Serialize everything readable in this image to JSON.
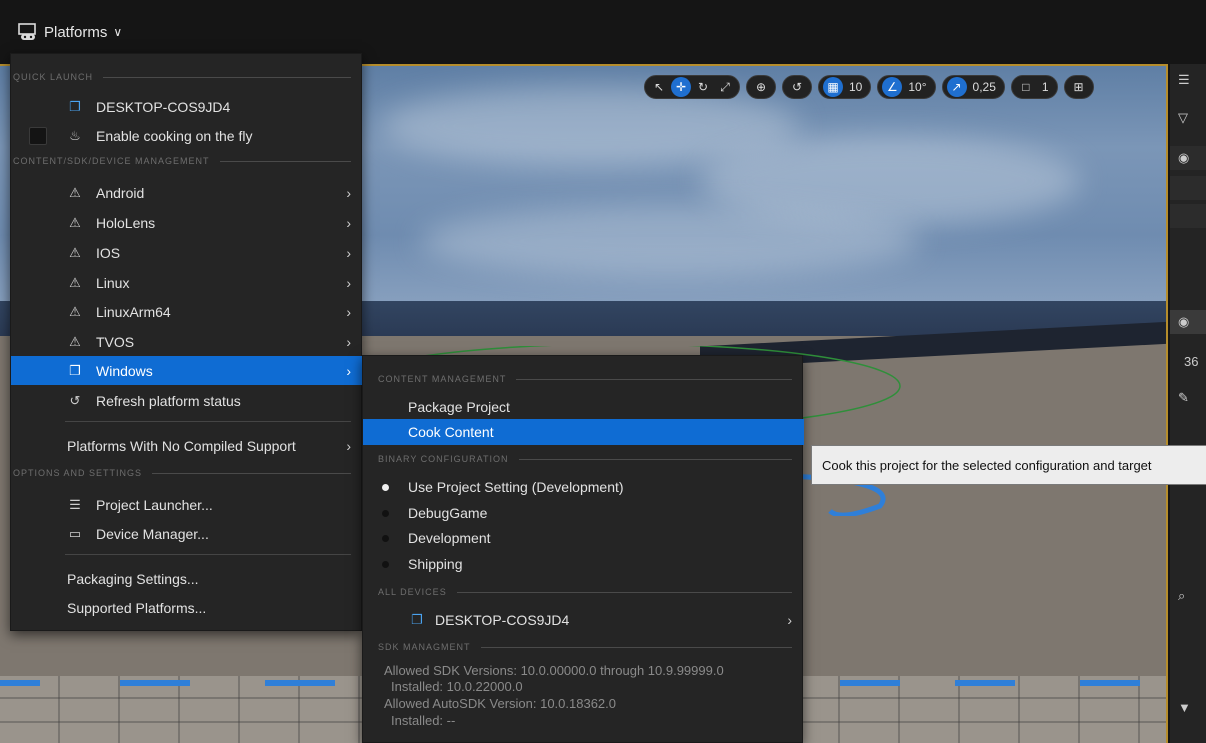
{
  "toolbar": {
    "platforms_label": "Platforms"
  },
  "viewport_toolbar": {
    "grid_snap": "10",
    "rotation_snap": "10°",
    "scale_snap": "0,25",
    "camera_speed": "1"
  },
  "menu": {
    "sections": {
      "quick_launch": "QUICK LAUNCH",
      "content_sdk": "CONTENT/SDK/DEVICE MANAGEMENT",
      "options": "OPTIONS AND SETTINGS"
    },
    "quick_launch_device": "DESKTOP-COS9JD4",
    "cook_on_fly": "Enable cooking on the fly",
    "platforms": [
      {
        "label": "Android"
      },
      {
        "label": "HoloLens"
      },
      {
        "label": "IOS"
      },
      {
        "label": "Linux"
      },
      {
        "label": "LinuxArm64"
      },
      {
        "label": "TVOS"
      }
    ],
    "windows": "Windows",
    "refresh": "Refresh platform status",
    "no_compiled": "Platforms With No Compiled Support",
    "project_launcher": "Project Launcher...",
    "device_manager": "Device Manager...",
    "packaging_settings": "Packaging Settings...",
    "supported_platforms": "Supported Platforms..."
  },
  "submenu": {
    "sections": {
      "content": "CONTENT MANAGEMENT",
      "binary": "BINARY CONFIGURATION",
      "devices": "ALL DEVICES",
      "sdk": "SDK MANAGMENT"
    },
    "package_project": "Package Project",
    "cook_content": "Cook Content",
    "configs": [
      {
        "label": "Use Project Setting (Development)",
        "selected": true
      },
      {
        "label": "DebugGame",
        "selected": false
      },
      {
        "label": "Development",
        "selected": false
      },
      {
        "label": "Shipping",
        "selected": false
      }
    ],
    "device": "DESKTOP-COS9JD4",
    "sdk_lines": [
      "Allowed SDK Versions: 10.0.00000.0 through 10.9.99999.0",
      "Installed: 10.0.22000.0",
      "Allowed AutoSDK Version: 10.0.18362.0",
      "Installed: --"
    ]
  },
  "tooltip": {
    "text": "Cook this project for the selected configuration and target"
  },
  "right_panel": {
    "value": "36"
  },
  "colors": {
    "highlight": "#0f6cd3",
    "viewport_border": "#b58d2c"
  }
}
